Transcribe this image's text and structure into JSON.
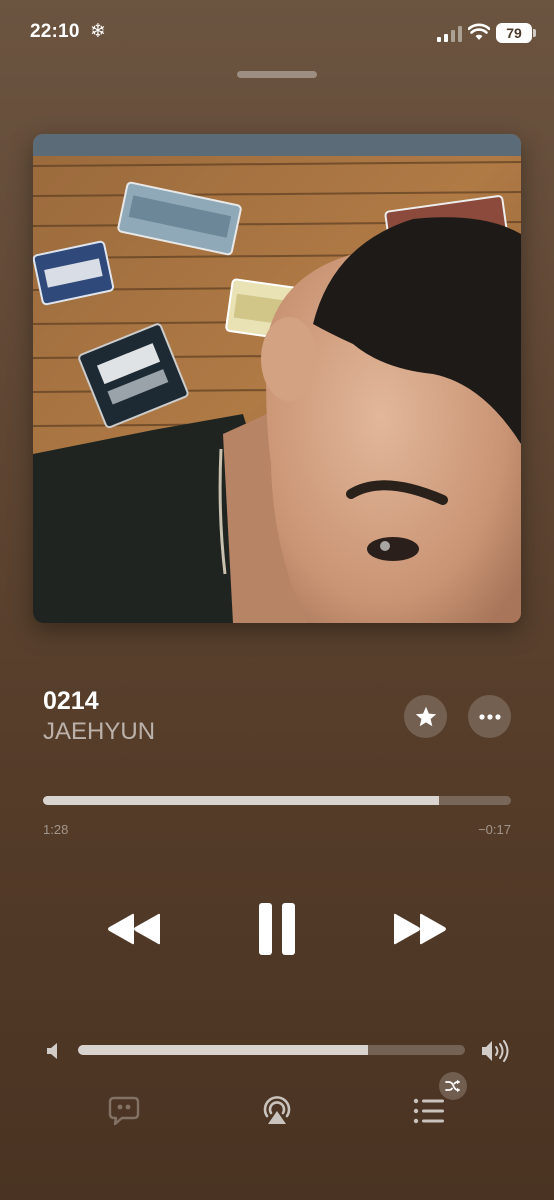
{
  "status": {
    "time": "22:10",
    "snow_glyph": "❄",
    "battery": "79"
  },
  "track": {
    "title": "0214",
    "artist": "JAEHYUN"
  },
  "playback": {
    "elapsed": "1:28",
    "remaining": "−0:17",
    "progress_fraction": 0.846
  },
  "volume": {
    "fraction": 0.75
  },
  "colors": {
    "accent": "#ffffff",
    "background_top": "#6b5440",
    "background_bottom": "#4a3322"
  }
}
